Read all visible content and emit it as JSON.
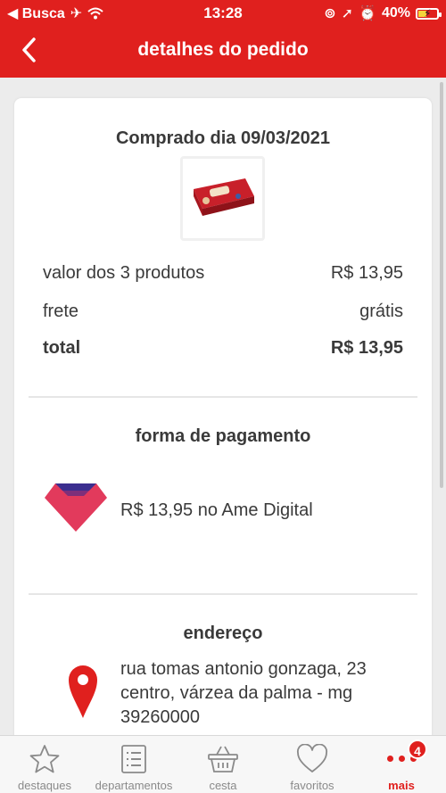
{
  "status_bar": {
    "carrier": "◀ Busca",
    "time": "13:28",
    "battery": "40%"
  },
  "header": {
    "title": "detalhes do pedido",
    "back_icon": "chevron-left-icon"
  },
  "order": {
    "purchased_label": "Comprado dia 09/03/2021",
    "product_image": "chocolate-box-image",
    "summary": [
      {
        "label": "valor dos 3 produtos",
        "value": "R$ 13,95"
      },
      {
        "label": "frete",
        "value": "grátis"
      },
      {
        "label": "total",
        "value": "R$ 13,95"
      }
    ]
  },
  "payment": {
    "title": "forma de pagamento",
    "icon": "ame-digital-logo",
    "text": "R$ 13,95 no Ame Digital",
    "logo_colors": {
      "top": "#3b2e8f",
      "bottom": "#e23a5c"
    }
  },
  "address": {
    "title": "endereço",
    "icon": "map-pin-icon",
    "line1": "rua tomas antonio gonzaga, 23",
    "line2": "centro, várzea da palma - mg",
    "line3": "39260000"
  },
  "bottom_nav": {
    "items": [
      {
        "label": "destaques",
        "icon": "star-icon"
      },
      {
        "label": "departamentos",
        "icon": "list-icon"
      },
      {
        "label": "cesta",
        "icon": "basket-icon"
      },
      {
        "label": "favoritos",
        "icon": "heart-icon"
      },
      {
        "label": "mais",
        "icon": "more-dots-icon",
        "badge": "4"
      }
    ]
  },
  "colors": {
    "brand": "#e0201e",
    "background": "#ececec"
  }
}
